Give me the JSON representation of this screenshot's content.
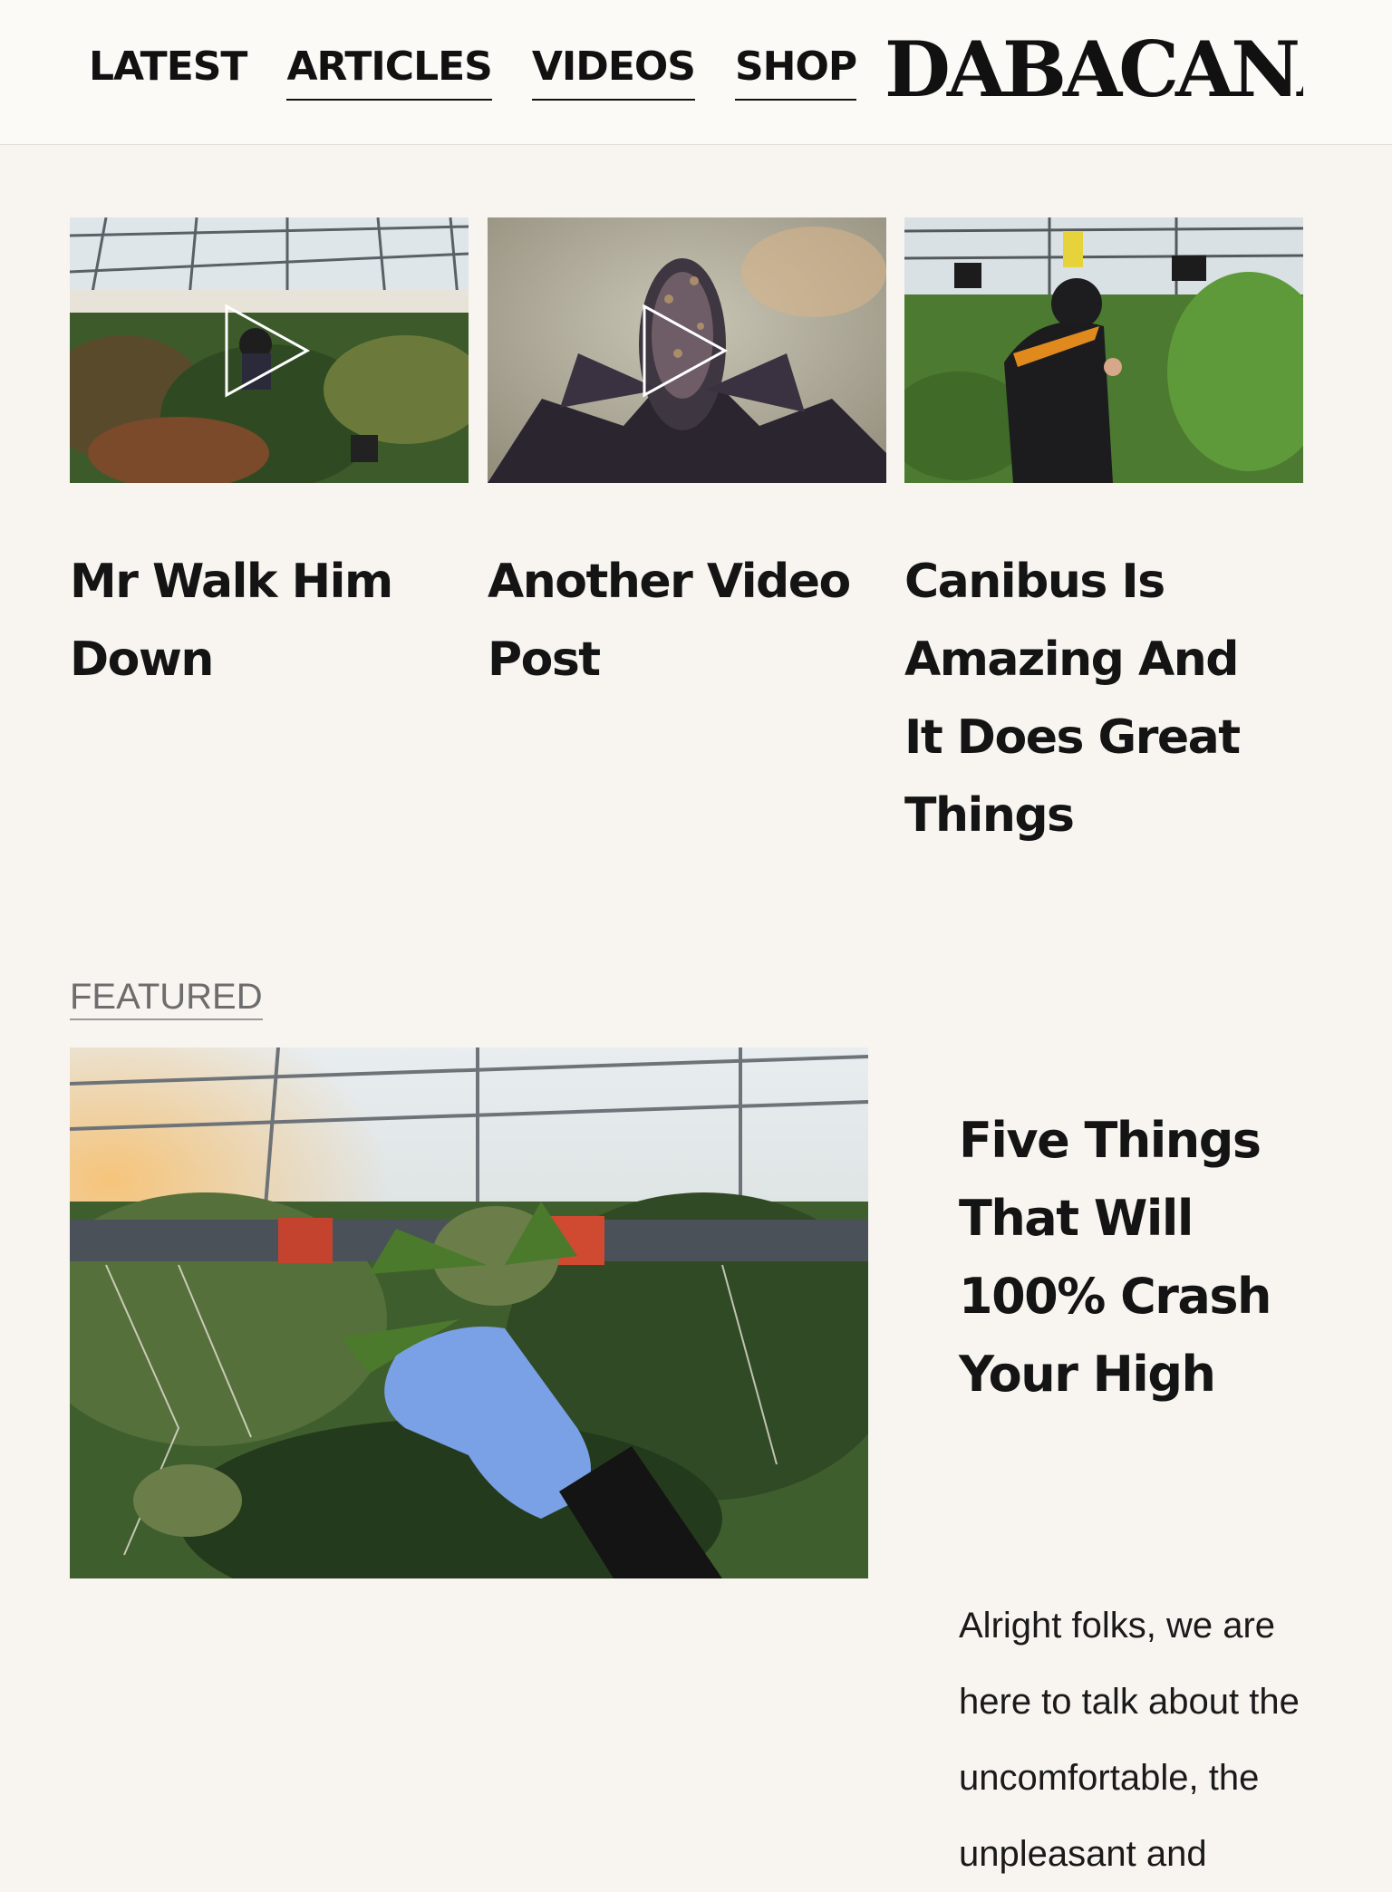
{
  "header": {
    "nav": [
      {
        "label": "LATEST"
      },
      {
        "label": "ARTICLES"
      },
      {
        "label": "VIDEOS"
      },
      {
        "label": "SHOP"
      }
    ],
    "logo_text": "DABACANA!"
  },
  "cards": [
    {
      "title": "Mr Walk Him Down",
      "icon": "play-icon",
      "image": "greenhouse-person-photo"
    },
    {
      "title": "Another Video Post",
      "icon": "play-icon",
      "image": "cannabis-bud-closeup-photo"
    },
    {
      "title": "Canibus Is Amazing And It Does Great Things",
      "image": "person-smelling-plant-photo"
    }
  ],
  "featured": {
    "label": "FEATURED",
    "title": "Five Things That Will 100% Crash Your High",
    "excerpt": "Alright folks, we are here to talk about the uncomfortable, the unpleasant and",
    "image": "gloved-hand-cannabis-photo"
  },
  "colors": {
    "background": "#f8f5f1",
    "header_bg": "#fcfaf6",
    "text": "#111111",
    "muted": "#6d6d6d",
    "glove": "#7aa0e6"
  }
}
